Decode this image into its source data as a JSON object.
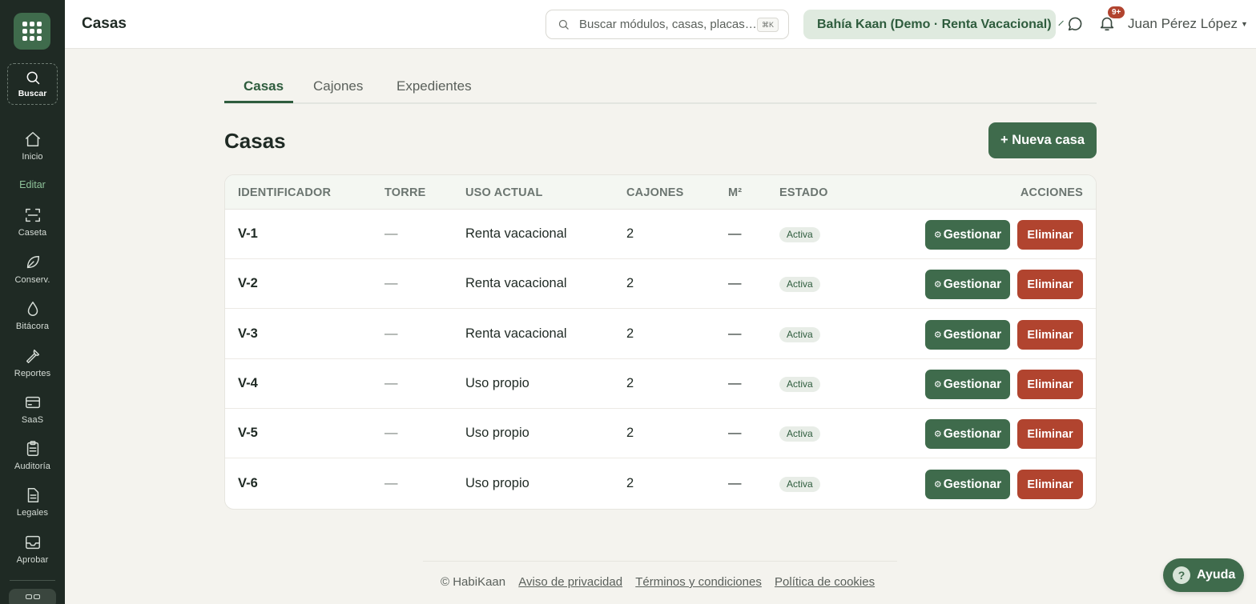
{
  "sidebar": {
    "search_label": "Buscar",
    "section_label": "Editar",
    "items": [
      {
        "label": "Inicio",
        "icon": "home-icon"
      },
      {
        "label": "Caseta",
        "icon": "scan-icon"
      },
      {
        "label": "Conserv.",
        "icon": "leaf-icon"
      },
      {
        "label": "Bitácora",
        "icon": "drop-icon"
      },
      {
        "label": "Reportes",
        "icon": "wrench-icon"
      },
      {
        "label": "SaaS",
        "icon": "card-icon"
      },
      {
        "label": "Auditoría",
        "icon": "clipboard-icon"
      },
      {
        "label": "Legales",
        "icon": "document-icon"
      },
      {
        "label": "Aprobar",
        "icon": "inbox-icon"
      }
    ]
  },
  "header": {
    "title": "Casas",
    "search_placeholder": "Buscar módulos, casas, placas…",
    "search_shortcut": "⌘K",
    "community": "Bahía Kaan (Demo · Renta Vacacional)",
    "notifications_badge": "9+",
    "user_name": "Juan Pérez López"
  },
  "tabs": [
    {
      "label": "Casas",
      "active": true
    },
    {
      "label": "Cajones",
      "active": false
    },
    {
      "label": "Expedientes",
      "active": false
    }
  ],
  "section": {
    "title": "Casas",
    "new_button": "+ Nueva casa"
  },
  "table": {
    "headers": [
      "IDENTIFICADOR",
      "TORRE",
      "USO ACTUAL",
      "CAJONES",
      "M²",
      "ESTADO",
      "ACCIONES"
    ],
    "manage_label": "Gestionar",
    "delete_label": "Eliminar",
    "rows": [
      {
        "id": "V-1",
        "torre": "—",
        "uso": "Renta vacacional",
        "cajones": "2",
        "m2": "—",
        "estado": "Activa"
      },
      {
        "id": "V-2",
        "torre": "—",
        "uso": "Renta vacacional",
        "cajones": "2",
        "m2": "—",
        "estado": "Activa"
      },
      {
        "id": "V-3",
        "torre": "—",
        "uso": "Renta vacacional",
        "cajones": "2",
        "m2": "—",
        "estado": "Activa"
      },
      {
        "id": "V-4",
        "torre": "—",
        "uso": "Uso propio",
        "cajones": "2",
        "m2": "—",
        "estado": "Activa"
      },
      {
        "id": "V-5",
        "torre": "—",
        "uso": "Uso propio",
        "cajones": "2",
        "m2": "—",
        "estado": "Activa"
      },
      {
        "id": "V-6",
        "torre": "—",
        "uso": "Uso propio",
        "cajones": "2",
        "m2": "—",
        "estado": "Activa"
      }
    ]
  },
  "footer": {
    "copyright": "© HabiKaan",
    "links": [
      "Aviso de privacidad",
      "Términos y condiciones",
      "Política de cookies"
    ]
  },
  "help_label": "Ayuda",
  "colors": {
    "sidebar": "#1f2a24",
    "primary": "#3f6b4c",
    "danger": "#b1442f",
    "background": "#f4f3ee"
  }
}
